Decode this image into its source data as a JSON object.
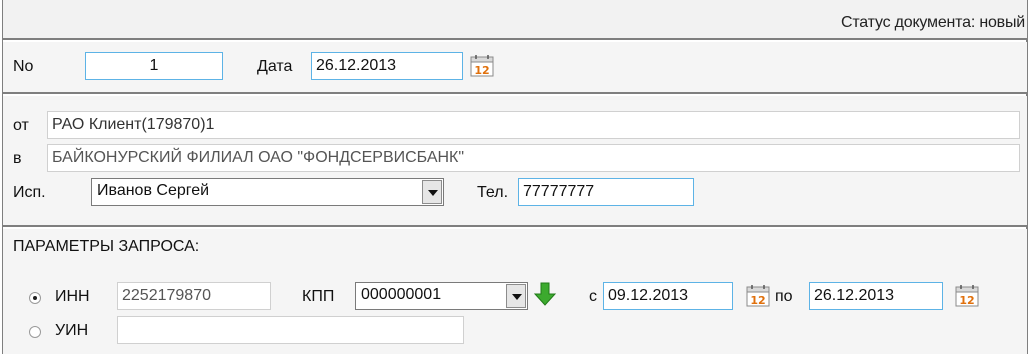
{
  "status": {
    "text": "Статус документа: новый"
  },
  "header": {
    "number_label": "No",
    "number_value": "1",
    "date_label": "Дата",
    "date_value": "26.12.2013",
    "calendar_icon": "calendar-icon"
  },
  "party": {
    "from_label": "от",
    "from_value": "РАО Клиент(179870)1",
    "to_label": "в",
    "to_value": "БАЙКОНУРСКИЙ ФИЛИАЛ ОАО \"ФОНДСЕРВИСБАНК\"",
    "executor_label": "Исп.",
    "executor_value": "Иванов Сергей",
    "phone_label": "Тел.",
    "phone_value": "77777777"
  },
  "params": {
    "title": "ПАРАМЕТРЫ ЗАПРОСА:",
    "inn_label": "ИНН",
    "inn_value": "2252179870",
    "inn_selected": true,
    "kpp_label": "КПП",
    "kpp_value": "000000001",
    "arrow_icon": "green-down-arrow-icon",
    "from_label": "с",
    "date_from": "09.12.2013",
    "to_label": "по",
    "date_to": "26.12.2013",
    "uin_label": "УИН",
    "uin_value": "",
    "uin_selected": false
  },
  "colors": {
    "field_border": "#5db3e6",
    "band_bg": "#f5f5f5",
    "divider": "#7f7f7f",
    "arrow": "#3caa2e"
  }
}
